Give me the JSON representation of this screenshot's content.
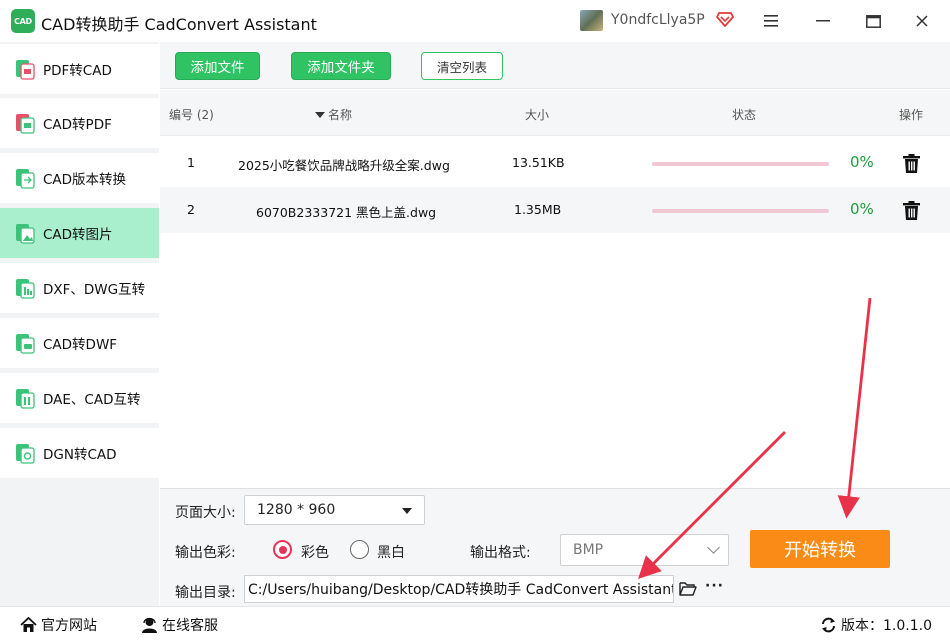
{
  "window": {
    "title": "CAD转换助手 CadConvert Assistant",
    "logo_text": "CAD",
    "user_name": "Y0ndfcLlya5P",
    "icons": {
      "menu": "menu-icon",
      "minimize": "minimize-icon",
      "maximize": "maximize-icon",
      "close": "close-icon",
      "vip": "vip-diamond-icon"
    }
  },
  "sidebar": {
    "items": [
      {
        "label": "PDF转CAD",
        "active": false
      },
      {
        "label": "CAD转PDF",
        "active": false
      },
      {
        "label": "CAD版本转换",
        "active": false
      },
      {
        "label": "CAD转图片",
        "active": true
      },
      {
        "label": "DXF、DWG互转",
        "active": false
      },
      {
        "label": "CAD转DWF",
        "active": false
      },
      {
        "label": "DAE、CAD互转",
        "active": false
      },
      {
        "label": "DGN转CAD",
        "active": false
      }
    ]
  },
  "toolbar": {
    "add_file": "添加文件",
    "add_folder": "添加文件夹",
    "clear_list": "清空列表"
  },
  "table": {
    "headers": {
      "index": "编号 (2)",
      "name": "名称",
      "size": "大小",
      "status": "状态",
      "action": "操作"
    },
    "rows": [
      {
        "index": "1",
        "name": "2025小吃餐饮品牌战略升级全案.dwg",
        "size": "13.51KB",
        "progress_label": "0%",
        "progress": 0
      },
      {
        "index": "2",
        "name": "6070B2333721 黑色上盖.dwg",
        "size": "1.35MB",
        "progress_label": "0%",
        "progress": 0
      }
    ]
  },
  "settings": {
    "page_size_label": "页面大小:",
    "page_size_value": "1280 * 960",
    "color_label": "输出色彩:",
    "color_option_color": "彩色",
    "color_option_bw": "黑白",
    "color_selected": "彩色",
    "format_label": "输出格式:",
    "format_value": "BMP",
    "output_dir_label": "输出目录:",
    "output_dir_value": "C:/Users/huibang/Desktop/CAD转换助手 CadConvert Assistant",
    "more_label": "···",
    "start_button": "开始转换"
  },
  "statusbar": {
    "website": "官方网站",
    "support": "在线客服",
    "version": "版本：1.0.1.0"
  },
  "colors": {
    "green": "#2fc364",
    "active_item": "#a9efcd",
    "orange": "#fb8b17",
    "radio_red": "#e8325a",
    "progress_track": "#f0c8d4",
    "percent_green": "#1d9b3c",
    "arrow_red": "#e8324a"
  }
}
